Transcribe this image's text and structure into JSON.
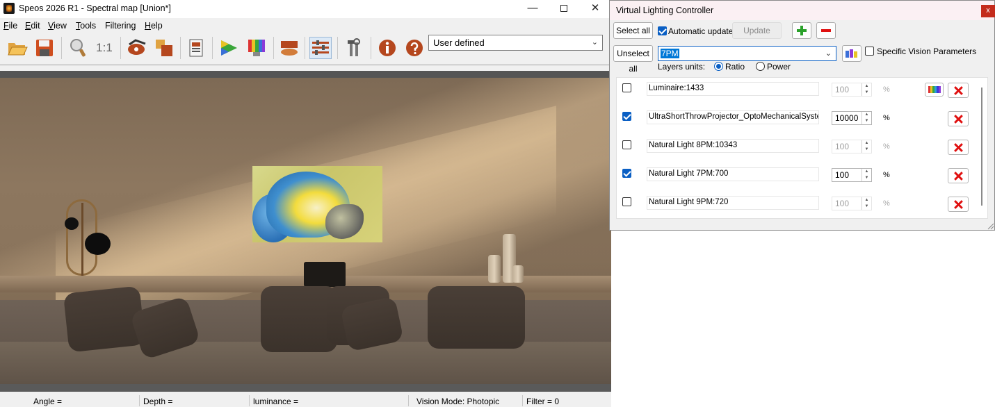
{
  "main_window": {
    "title": "Speos 2026 R1 - Spectral map [Union*]",
    "controls": {
      "minimize": "—",
      "close": "✕"
    },
    "menu": [
      {
        "label": "File",
        "key": "F",
        "rest": "ile"
      },
      {
        "label": "Edit",
        "key": "E",
        "rest": "dit"
      },
      {
        "label": "View",
        "key": "V",
        "rest": "iew"
      },
      {
        "label": "Tools",
        "key": "T",
        "rest": "ools"
      },
      {
        "label": "Filtering",
        "key": "",
        "rest": "Filtering"
      },
      {
        "label": "Help",
        "key": "H",
        "rest": "elp"
      }
    ],
    "toolbar": {
      "icons": [
        "open-folder-icon",
        "save-icon",
        "zoom-icon",
        "zoom-one-to-one-icon",
        "eye-settings-icon",
        "layers-icon",
        "document-icon",
        "color-prism-icon",
        "color-palette-icon",
        "surface-icon",
        "sliders-icon",
        "tools-icon",
        "info-icon",
        "help-icon"
      ],
      "zoom_one_to_one": "1:1",
      "preset_select": "User defined"
    },
    "status": {
      "angle": "Angle =",
      "depth": "Depth =",
      "luminance": "luminance =",
      "vision_mode": "Vision Mode: Photopic",
      "filter": "Filter = 0"
    }
  },
  "vlc": {
    "title": "Virtual Lighting Controller",
    "close": "x",
    "select_all": "Select all",
    "unselect_all": "Unselect all",
    "automatic_update": "Automatic update",
    "automatic_update_checked": true,
    "update": "Update",
    "filter_value": "7PM",
    "specific_vision": "Specific Vision Parameters",
    "specific_vision_checked": false,
    "layers_units_label": "Layers units:",
    "units": [
      {
        "label": "Ratio",
        "selected": true
      },
      {
        "label": "Power",
        "selected": false
      }
    ],
    "layers": [
      {
        "name": "Luminaire:1433",
        "checked": false,
        "value": "100",
        "unit": "%",
        "has_color": true
      },
      {
        "name": "UltraShortThrowProjector_OptoMechanicalSystem/D",
        "checked": true,
        "value": "10000",
        "unit": "%",
        "has_color": false
      },
      {
        "name": "Natural Light 8PM:10343",
        "checked": false,
        "value": "100",
        "unit": "%",
        "has_color": false
      },
      {
        "name": "Natural Light 7PM:700",
        "checked": true,
        "value": "100",
        "unit": "%",
        "has_color": false
      },
      {
        "name": "Natural Light 9PM:720",
        "checked": false,
        "value": "100",
        "unit": "%",
        "has_color": false
      }
    ]
  },
  "colors": {
    "accent": "#0a5fc4",
    "close_red": "#c42b1c",
    "delete_red": "#e01010",
    "add_green": "#2aa12a"
  }
}
